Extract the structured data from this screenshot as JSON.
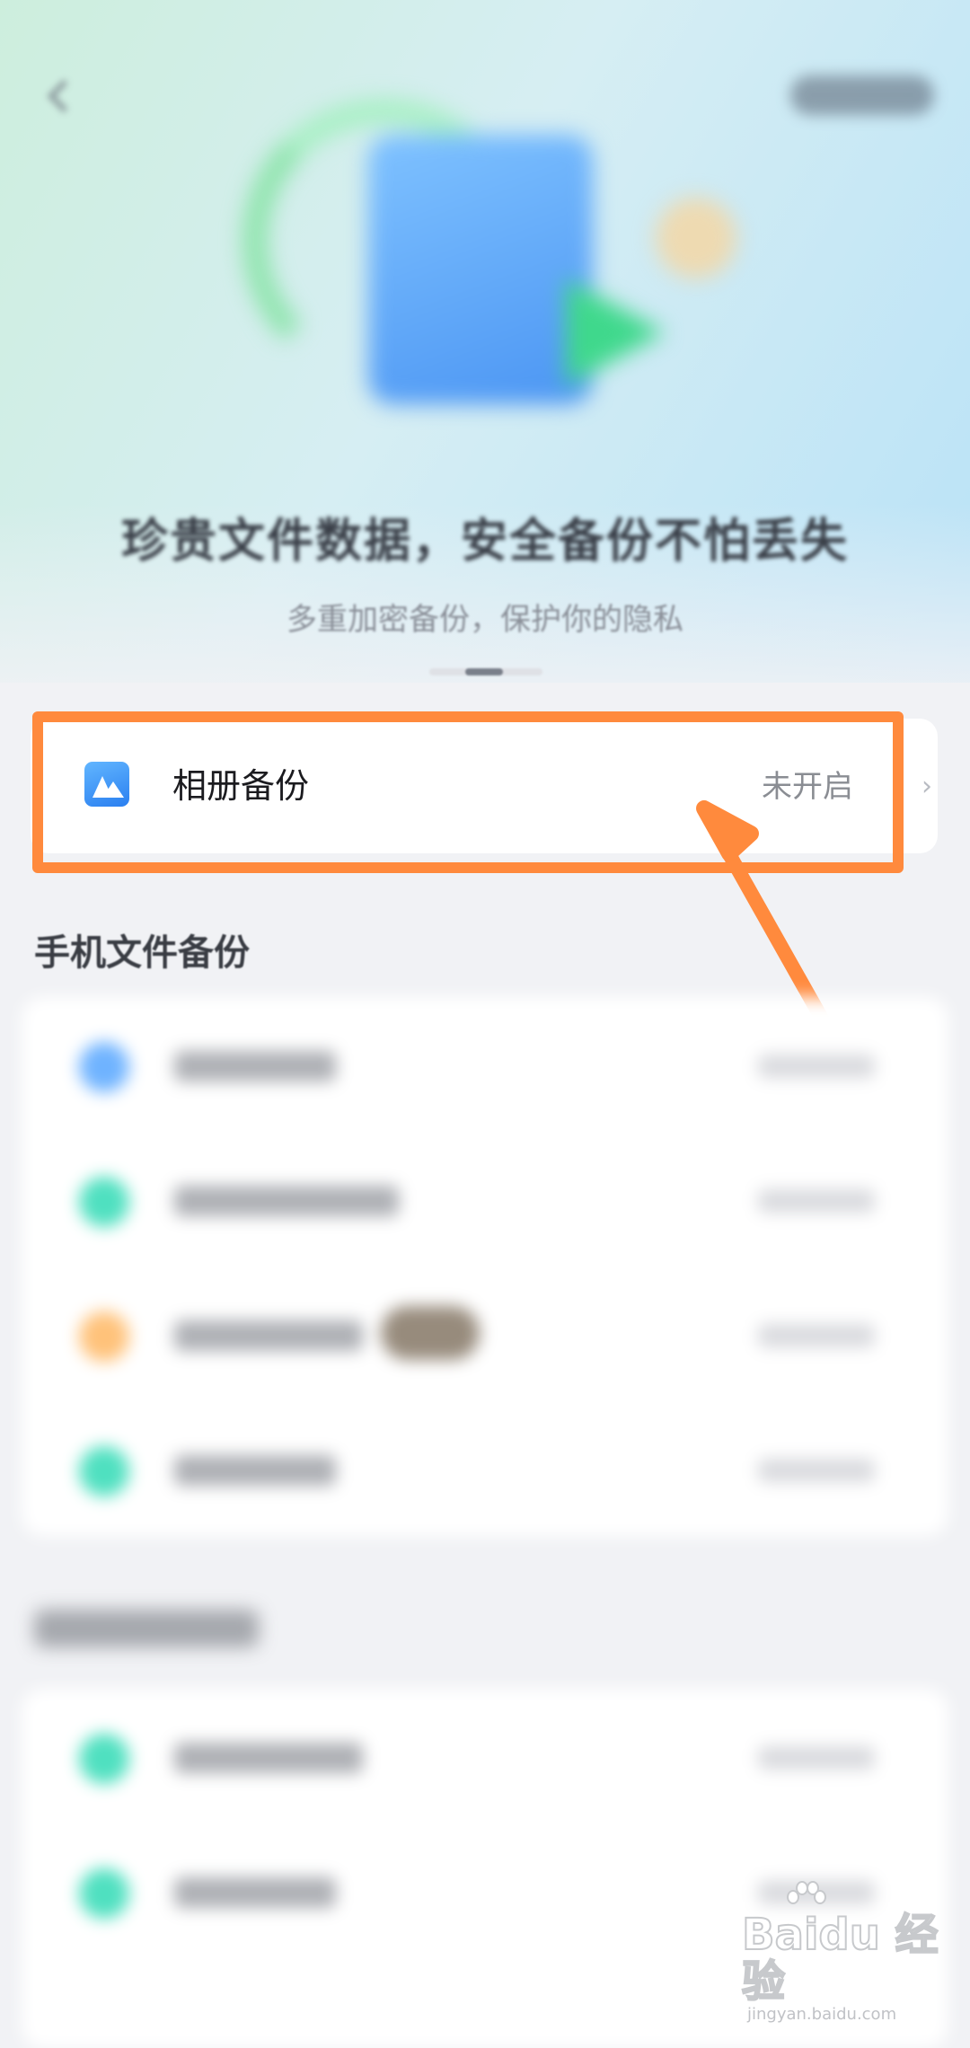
{
  "hero": {
    "title": "珍贵文件数据，安全备份不怕丢失",
    "subtitle": "多重加密备份，保护你的隐私",
    "pages_total": 3,
    "page_active": 2
  },
  "album_backup": {
    "label": "相册备份",
    "status": "未开启",
    "chevron": "›",
    "icon": "photo-album-icon"
  },
  "annotation": {
    "color": "#ff8a3d"
  },
  "sections": [
    {
      "title": "手机文件备份",
      "rows": [
        {
          "icon_color": "#6fb3ff"
        },
        {
          "icon_color": "#4fe0c0"
        },
        {
          "icon_color": "#ffc27a"
        },
        {
          "icon_color": "#4fe0c0"
        }
      ]
    },
    {
      "title": "",
      "rows": [
        {
          "icon_color": "#4fe0c0"
        },
        {
          "icon_color": "#4fe0c0"
        }
      ]
    }
  ],
  "watermark": {
    "main": "Baidu 经验",
    "sub": "jingyan.baidu.com"
  }
}
